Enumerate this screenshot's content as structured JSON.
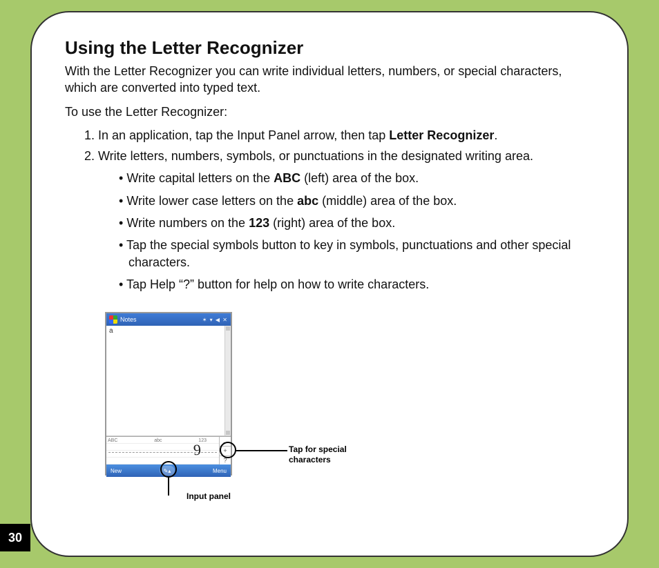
{
  "page_number": "30",
  "title": "Using the Letter Recognizer",
  "intro": "With the Letter Recognizer you can write individual letters, numbers, or special characters, which are converted into typed text.",
  "lead_in": "To use the Letter Recognizer:",
  "steps": {
    "s1_pre": "In an application, tap the Input Panel arrow, then tap ",
    "s1_bold": "Letter Recognizer",
    "s1_post": ".",
    "s2": "Write letters, numbers, symbols, or punctuations in the designated writing area."
  },
  "bullets": {
    "b1_pre": "Write capital letters on the ",
    "b1_bold": "ABC",
    "b1_post": " (left) area of the box.",
    "b2_pre": "Write lower case letters on the ",
    "b2_bold": "abc",
    "b2_post": " (middle) area of the box.",
    "b3_pre": "Write numbers on the ",
    "b3_bold": "123",
    "b3_post": " (right) area of the box.",
    "b4": "Tap the special symbols button to key in symbols, punctuations and other special characters.",
    "b5": "Tap Help “?” button for help on how to write characters."
  },
  "figure": {
    "app_title": "Notes",
    "status": "✶ ▾ ◀  ✕",
    "typed_char": "a",
    "zones": {
      "left": "ABC",
      "mid": "abc",
      "right": "123"
    },
    "glyph": "9",
    "side": {
      "top": "←",
      "mid": "+",
      "bot": "?"
    },
    "soft_left": "New",
    "soft_center": "✎▴",
    "soft_right": "Menu",
    "callout_special_1": "Tap for special",
    "callout_special_2": "characters",
    "callout_input_panel": "Input panel"
  }
}
